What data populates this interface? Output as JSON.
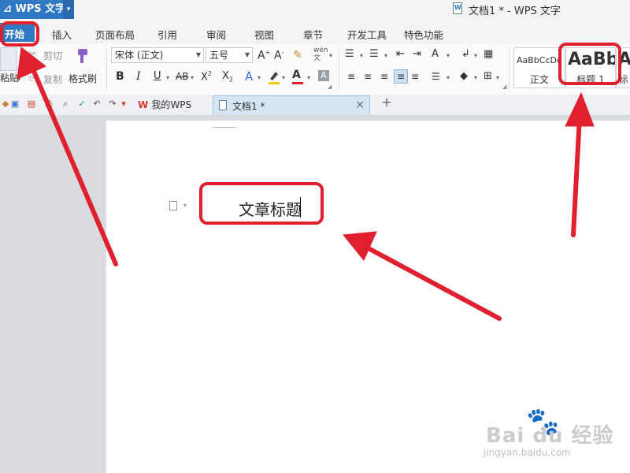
{
  "app": {
    "name": "WPS 文字",
    "window_title": "文档1 * - WPS 文字"
  },
  "menu_tabs": [
    "开始",
    "插入",
    "页面布局",
    "引用",
    "审阅",
    "视图",
    "章节",
    "开发工具",
    "特色功能"
  ],
  "clipboard": {
    "paste": "粘贴",
    "cut": "剪切",
    "copy": "复制",
    "format_painter": "格式刷"
  },
  "font": {
    "family": "宋体 (正文)",
    "size": "五号"
  },
  "styles": [
    {
      "sample": "AaBbCcDd",
      "label": "正文"
    },
    {
      "sample": "AaBb",
      "label": "标题 1"
    },
    {
      "sample": "A",
      "label": "标"
    }
  ],
  "doc_tabs": {
    "home": "我的WPS",
    "current": "文档1 *",
    "close": "×",
    "add": "+"
  },
  "document": {
    "heading": "文章标题"
  },
  "watermark": {
    "text": "Bai du 经验",
    "paw": "🐾",
    "url": "jingyan.baidu.com"
  },
  "colors": {
    "accent": "#2f78c4",
    "annotation": "#e0202e"
  }
}
